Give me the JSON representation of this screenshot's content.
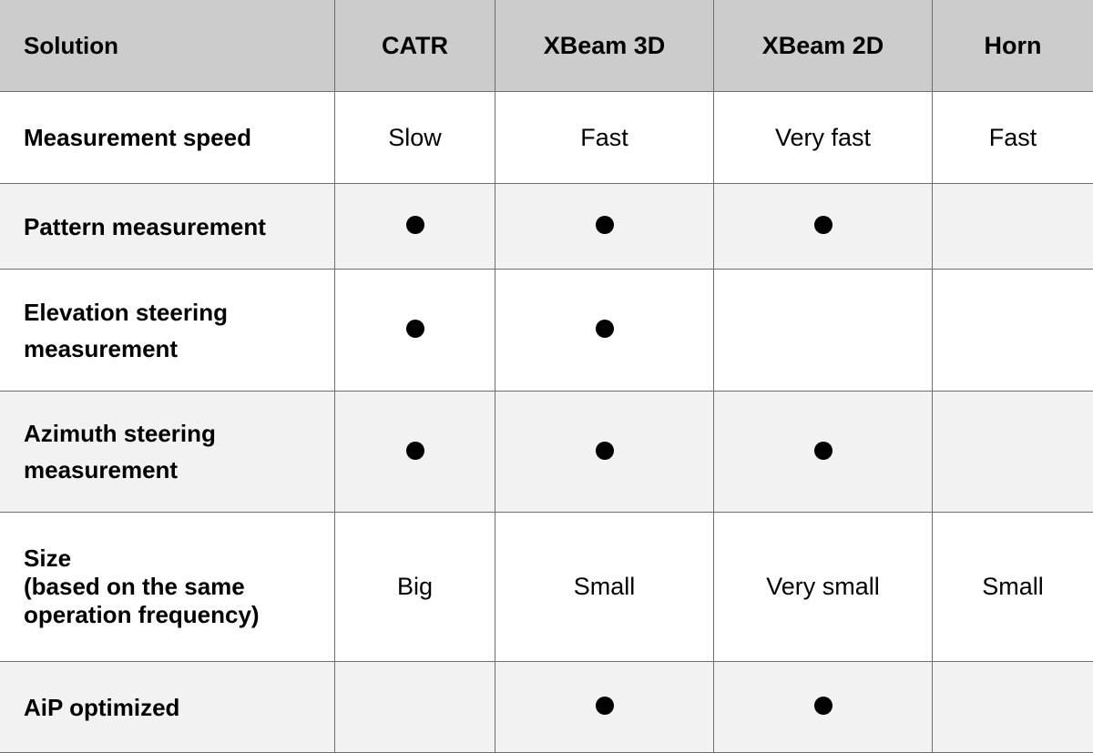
{
  "header": [
    "Solution",
    "CATR",
    "XBeam 3D",
    "XBeam 2D",
    "Horn"
  ],
  "rows": [
    {
      "label": "Measurement speed",
      "cells": [
        "Slow",
        "Fast",
        "Very fast",
        "Fast"
      ]
    },
    {
      "label": "Pattern measurement",
      "cells": [
        true,
        true,
        true,
        false
      ]
    },
    {
      "label": "Elevation steering\nmeasurement",
      "cells": [
        true,
        true,
        false,
        false
      ]
    },
    {
      "label": "Azimuth steering\nmeasurement",
      "cells": [
        true,
        true,
        true,
        false
      ]
    },
    {
      "label": "Size\n(based on the same\noperation frequency)",
      "cells": [
        "Big",
        "Small",
        "Very small",
        "Small"
      ]
    },
    {
      "label": "AiP optimized",
      "cells": [
        false,
        true,
        true,
        false
      ]
    }
  ],
  "mark_icon": "filled-circle-icon"
}
